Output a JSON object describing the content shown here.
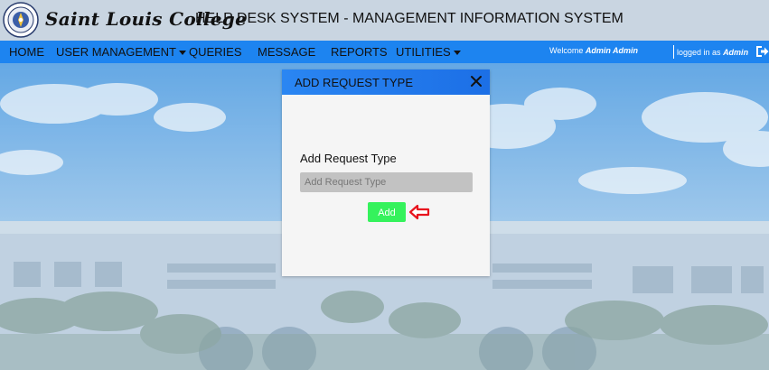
{
  "header": {
    "college_name": "Saint Louis College",
    "system_title": "HELP DESK SYSTEM - MANAGEMENT INFORMATION SYSTEM",
    "logo_icon": "college-seal-icon"
  },
  "nav": {
    "items": [
      {
        "label": "HOME",
        "has_dropdown": false
      },
      {
        "label": "USER MANAGEMENT",
        "has_dropdown": true
      },
      {
        "label": "QUERIES",
        "has_dropdown": false
      },
      {
        "label": "MESSAGE",
        "has_dropdown": false
      },
      {
        "label": "REPORTS",
        "has_dropdown": false
      },
      {
        "label": "UTILITIES",
        "has_dropdown": true
      }
    ],
    "welcome_prefix": "Welcome",
    "welcome_name": "Admin Admin",
    "logged_prefix": "logged in as",
    "logged_user": "Admin",
    "logout_icon": "logout-icon",
    "background_color": "#1d84f0"
  },
  "modal": {
    "title": "ADD REQUEST TYPE",
    "close_label": "✕",
    "field_label": "Add Request Type",
    "field_placeholder": "Add Request Type",
    "field_value": "",
    "add_label": "Add",
    "header_color": "#1c6fe6",
    "add_color": "#35f25c"
  },
  "annotation": {
    "arrow_icon": "red-left-arrow-icon",
    "arrow_color": "#e8141e"
  }
}
